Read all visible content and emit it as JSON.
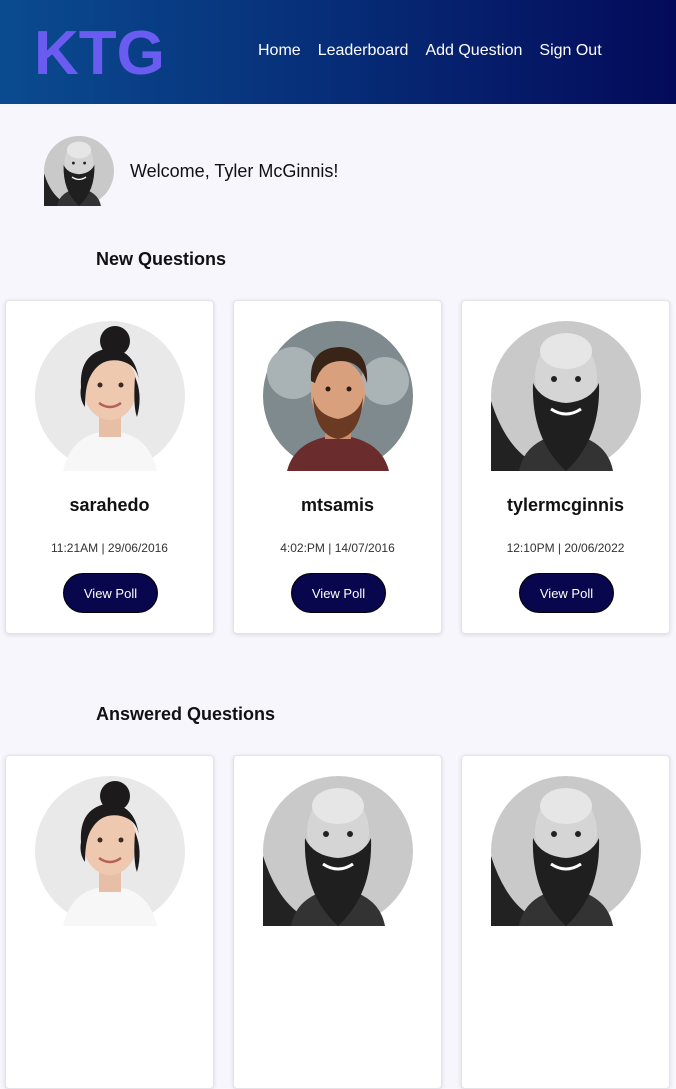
{
  "nav": {
    "logo_text": "KTG",
    "items": [
      "Home",
      "Leaderboard",
      "Add Question",
      "Sign Out"
    ]
  },
  "welcome": {
    "text": "Welcome, Tyler McGinnis!"
  },
  "sections": {
    "new_title": "New Questions",
    "answered_title": "Answered Questions"
  },
  "new_questions": [
    {
      "author": "sarahedo",
      "time": "11:21AM | 29/06/2016",
      "button": "View Poll",
      "avatar": "woman-portrait"
    },
    {
      "author": "mtsamis",
      "time": "4:02:PM | 14/07/2016",
      "button": "View Poll",
      "avatar": "young-man-portrait"
    },
    {
      "author": "tylermcginnis",
      "time": "12:10PM | 20/06/2022",
      "button": "View Poll",
      "avatar": "bearded-man-bw-portrait"
    }
  ],
  "answered_questions": [
    {
      "avatar": "woman-portrait"
    },
    {
      "avatar": "bearded-man-bw-portrait"
    },
    {
      "avatar": "bearded-man-bw-portrait"
    }
  ],
  "colors": {
    "header_start": "#0a4b90",
    "header_end": "#040a5a",
    "logo": "#6a5cf0",
    "button": "#08064d",
    "page_bg": "#f6f6fc"
  }
}
